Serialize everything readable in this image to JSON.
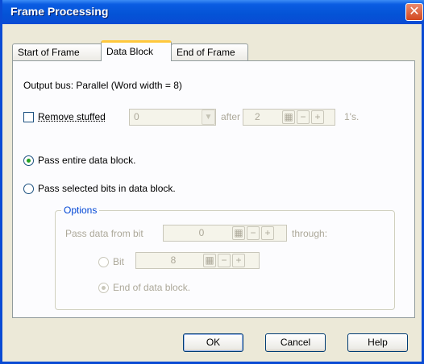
{
  "window": {
    "title": "Frame Processing",
    "close_glyph": "✕"
  },
  "tabs": [
    {
      "label": "Start of Frame",
      "active": false
    },
    {
      "label": "Data Block",
      "active": true
    },
    {
      "label": "End of Frame",
      "active": false
    }
  ],
  "output_bus": "Output bus: Parallel (Word width = 8)",
  "remove_stuffed": {
    "label": "Remove stuffed",
    "checked": false,
    "value": "0",
    "after_label": "after",
    "count": "2",
    "suffix": "1's."
  },
  "pass_entire": {
    "label": "Pass entire data block.",
    "selected": true
  },
  "pass_selected": {
    "label": "Pass selected bits in data block.",
    "selected": false
  },
  "options": {
    "title": "Options",
    "pass_from_label": "Pass data from bit",
    "from_value": "0",
    "through_label": "through:",
    "bit_label": "Bit",
    "bit_value": "8",
    "end_label": "End of data block."
  },
  "stepper_glyphs": {
    "calc": "▦",
    "minus": "−",
    "plus": "+"
  },
  "buttons": {
    "ok": "OK",
    "cancel": "Cancel",
    "help": "Help"
  }
}
